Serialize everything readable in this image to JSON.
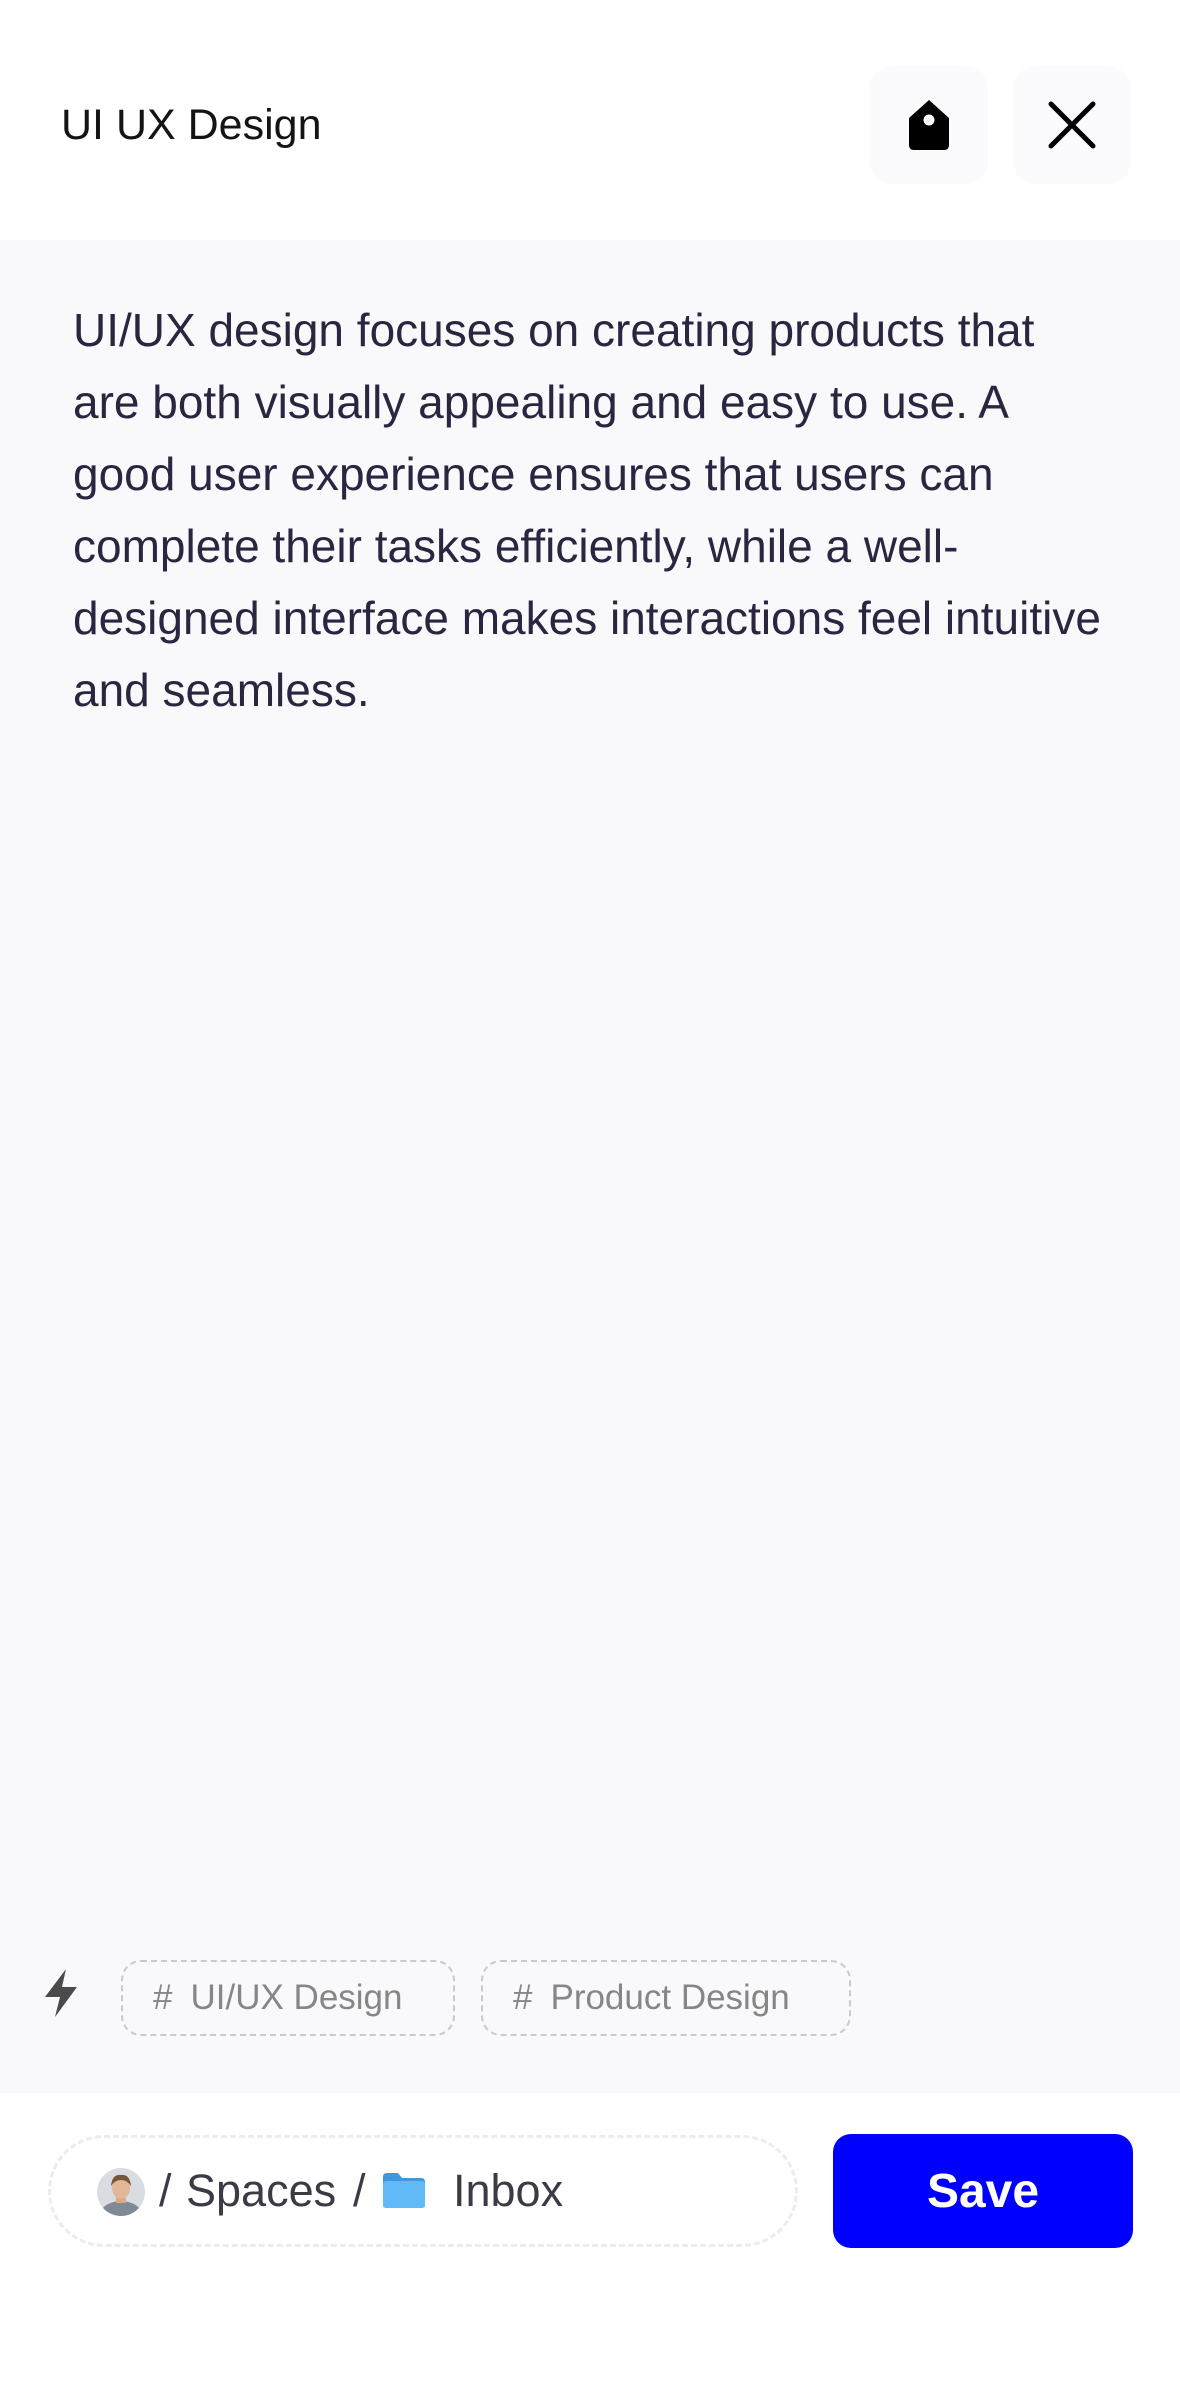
{
  "header": {
    "title": "UI UX Design",
    "tag_icon": "tag-icon",
    "close_icon": "close-icon"
  },
  "note": {
    "body": "UI/UX design focuses on creating products that are both visually appealing and easy to use. A good user experience ensures that users can complete their tasks efficiently, while a well-designed interface makes interactions feel intuitive and seamless."
  },
  "tags": {
    "bolt_icon": "lightning-icon",
    "items": [
      {
        "hash": "#",
        "label": "UI/UX Design"
      },
      {
        "hash": "#",
        "label": "Product Design"
      }
    ]
  },
  "location": {
    "avatar_icon": "user-avatar",
    "separator": "/",
    "space": "Spaces",
    "folder_icon": "folder-icon",
    "folder": "Inbox"
  },
  "actions": {
    "save_label": "Save"
  },
  "colors": {
    "accent": "#0000FE",
    "background": "#F9F9FC",
    "text": "#2B2540",
    "folder": "#5BB3F5"
  }
}
